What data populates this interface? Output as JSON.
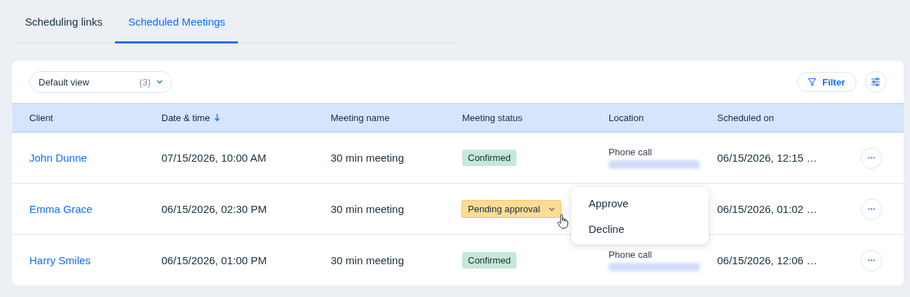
{
  "tabs": [
    {
      "label": "Scheduling links",
      "selected": false
    },
    {
      "label": "Scheduled Meetings",
      "selected": true
    }
  ],
  "toolbar": {
    "view": {
      "label": "Default view",
      "count": "(3)"
    },
    "filter_button": "Filter"
  },
  "table": {
    "columns": [
      {
        "label": "Client",
        "sorted": false
      },
      {
        "label": "Date & time",
        "sorted": true
      },
      {
        "label": "Meeting name",
        "sorted": false
      },
      {
        "label": "Meeting status",
        "sorted": false
      },
      {
        "label": "Location",
        "sorted": false
      },
      {
        "label": "Scheduled on",
        "sorted": false
      }
    ],
    "rows": [
      {
        "client": "John Dunne",
        "date_time": "07/15/2026, 10:00 AM",
        "meeting_name": "30 min meeting",
        "status": {
          "kind": "confirmed",
          "label": "Confirmed",
          "menu_open": false
        },
        "location": "Phone call",
        "scheduled_on": "06/15/2026, 12:15 …"
      },
      {
        "client": "Emma Grace",
        "date_time": "06/15/2026, 02:30 PM",
        "meeting_name": "30 min meeting",
        "status": {
          "kind": "pending",
          "label": "Pending approval",
          "menu_open": true
        },
        "scheduled_on": "06/15/2026, 01:02 …"
      },
      {
        "client": "Harry Smiles",
        "date_time": "06/15/2026, 01:00 PM",
        "meeting_name": "30 min meeting",
        "status": {
          "kind": "confirmed",
          "label": "Confirmed",
          "menu_open": false
        },
        "location": "Phone call",
        "scheduled_on": "06/15/2026, 12:06 …"
      }
    ]
  },
  "status_menu": {
    "items": [
      "Approve",
      "Decline"
    ]
  }
}
